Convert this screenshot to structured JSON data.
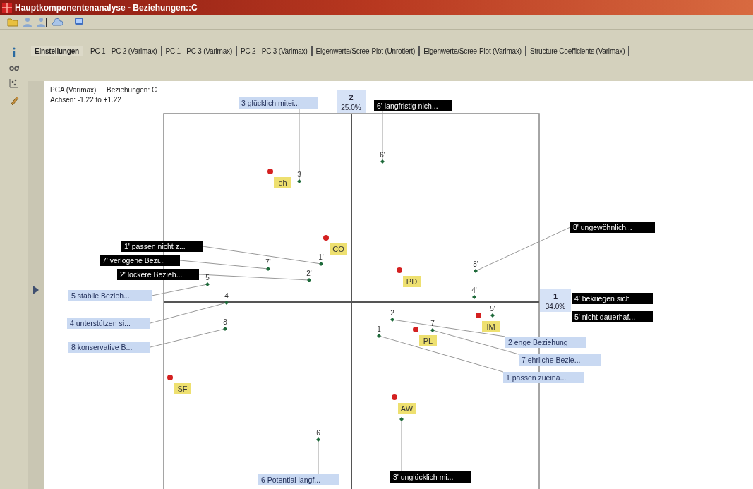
{
  "window": {
    "title": "Hauptkomponentenanalyse - Beziehungen::C"
  },
  "tabs": [
    {
      "label": "Einstellungen",
      "selected": true
    },
    {
      "label": "PC 1 - PC 2 (Varimax)",
      "selected": false
    },
    {
      "label": "PC 1 - PC 3 (Varimax)",
      "selected": false
    },
    {
      "label": "PC 2 - PC 3 (Varimax)",
      "selected": false
    },
    {
      "label": "Eigenwerte/Scree-Plot (Unrotiert)",
      "selected": false
    },
    {
      "label": "Eigenwerte/Scree-Plot (Varimax)",
      "selected": false
    },
    {
      "label": "Structure Coefficients (Varimax)",
      "selected": false
    }
  ],
  "plot": {
    "title": "PCA (Varimax)",
    "subtitle": "Beziehungen: C",
    "range": "Achsen: -1.22 to +1.22",
    "axes": [
      {
        "number": "2",
        "percent": "25.0%"
      },
      {
        "number": "1",
        "percent": "34.0%"
      }
    ],
    "constructs": [
      {
        "marker": "3",
        "label": "3 glücklich mitei...",
        "kind": "pole"
      },
      {
        "marker": "6'",
        "label": "6' langfristig nich...",
        "kind": "contrast"
      },
      {
        "marker": "1'",
        "label": "1' passen nicht z...",
        "kind": "contrast"
      },
      {
        "marker": "7'",
        "label": "7' verlogene Bezi...",
        "kind": "contrast"
      },
      {
        "marker": "2'",
        "label": "2' lockere Bezieh...",
        "kind": "contrast"
      },
      {
        "marker": "5",
        "label": "5 stabile Bezieh...",
        "kind": "pole"
      },
      {
        "marker": "4",
        "label": "4 unterstützen si...",
        "kind": "pole"
      },
      {
        "marker": "8",
        "label": "8 konservative B...",
        "kind": "pole"
      },
      {
        "marker": "6",
        "label": "6 Potential langf...",
        "kind": "pole"
      },
      {
        "marker": "8'",
        "label": "8' ungewöhnlich...",
        "kind": "contrast"
      },
      {
        "marker": "4'",
        "label": "4' bekriegen sich",
        "kind": "contrast"
      },
      {
        "marker": "5'",
        "label": "5' nicht dauerhaf...",
        "kind": "contrast"
      },
      {
        "marker": "2",
        "label": "2 enge Beziehung",
        "kind": "pole"
      },
      {
        "marker": "7",
        "label": "7 ehrliche Bezie...",
        "kind": "pole"
      },
      {
        "marker": "1",
        "label": "1 passen zueina...",
        "kind": "pole"
      },
      {
        "label": "3' unglücklich mi...",
        "kind": "contrast"
      }
    ],
    "elements": [
      {
        "label": "eh"
      },
      {
        "label": "CO"
      },
      {
        "label": "PD"
      },
      {
        "label": "IM"
      },
      {
        "label": "PL"
      },
      {
        "label": "SF"
      },
      {
        "label": "AW"
      }
    ]
  }
}
